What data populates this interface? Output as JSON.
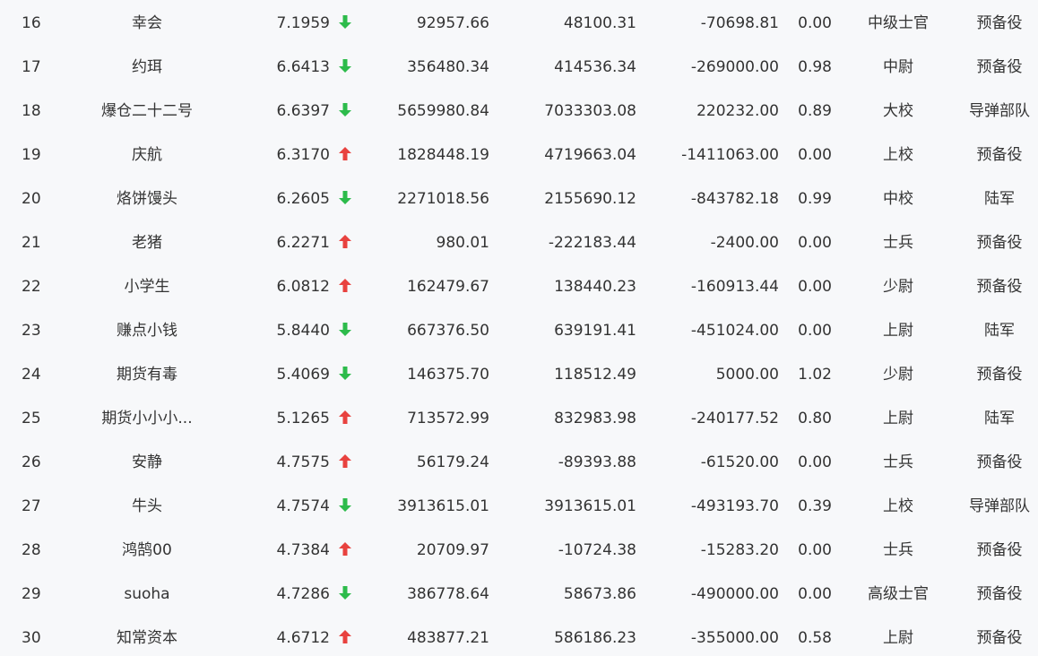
{
  "colors": {
    "up": "#e8423f",
    "down": "#2dbb4b",
    "text": "#333333",
    "background": "#f7f8fa"
  },
  "rows": [
    {
      "rank": "16",
      "name": "幸会",
      "score": "7.1959",
      "trend": "down",
      "value1": "92957.66",
      "value2": "48100.31",
      "value3": "-70698.81",
      "ratio": "0.00",
      "rank_title": "中级士官",
      "unit": "预备役"
    },
    {
      "rank": "17",
      "name": "约珥",
      "score": "6.6413",
      "trend": "down",
      "value1": "356480.34",
      "value2": "414536.34",
      "value3": "-269000.00",
      "ratio": "0.98",
      "rank_title": "中尉",
      "unit": "预备役"
    },
    {
      "rank": "18",
      "name": "爆仓二十二号",
      "score": "6.6397",
      "trend": "down",
      "value1": "5659980.84",
      "value2": "7033303.08",
      "value3": "220232.00",
      "ratio": "0.89",
      "rank_title": "大校",
      "unit": "导弹部队"
    },
    {
      "rank": "19",
      "name": "庆航",
      "score": "6.3170",
      "trend": "up",
      "value1": "1828448.19",
      "value2": "4719663.04",
      "value3": "-1411063.00",
      "ratio": "0.00",
      "rank_title": "上校",
      "unit": "预备役"
    },
    {
      "rank": "20",
      "name": "烙饼馒头",
      "score": "6.2605",
      "trend": "down",
      "value1": "2271018.56",
      "value2": "2155690.12",
      "value3": "-843782.18",
      "ratio": "0.99",
      "rank_title": "中校",
      "unit": "陆军"
    },
    {
      "rank": "21",
      "name": "老猪",
      "score": "6.2271",
      "trend": "up",
      "value1": "980.01",
      "value2": "-222183.44",
      "value3": "-2400.00",
      "ratio": "0.00",
      "rank_title": "士兵",
      "unit": "预备役"
    },
    {
      "rank": "22",
      "name": "小学生",
      "score": "6.0812",
      "trend": "up",
      "value1": "162479.67",
      "value2": "138440.23",
      "value3": "-160913.44",
      "ratio": "0.00",
      "rank_title": "少尉",
      "unit": "预备役"
    },
    {
      "rank": "23",
      "name": "赚点小钱",
      "score": "5.8440",
      "trend": "down",
      "value1": "667376.50",
      "value2": "639191.41",
      "value3": "-451024.00",
      "ratio": "0.00",
      "rank_title": "上尉",
      "unit": "陆军"
    },
    {
      "rank": "24",
      "name": "期货有毒",
      "score": "5.4069",
      "trend": "down",
      "value1": "146375.70",
      "value2": "118512.49",
      "value3": "5000.00",
      "ratio": "1.02",
      "rank_title": "少尉",
      "unit": "预备役"
    },
    {
      "rank": "25",
      "name": "期货小小小...",
      "score": "5.1265",
      "trend": "up",
      "value1": "713572.99",
      "value2": "832983.98",
      "value3": "-240177.52",
      "ratio": "0.80",
      "rank_title": "上尉",
      "unit": "陆军"
    },
    {
      "rank": "26",
      "name": "安静",
      "score": "4.7575",
      "trend": "up",
      "value1": "56179.24",
      "value2": "-89393.88",
      "value3": "-61520.00",
      "ratio": "0.00",
      "rank_title": "士兵",
      "unit": "预备役"
    },
    {
      "rank": "27",
      "name": "牛头",
      "score": "4.7574",
      "trend": "down",
      "value1": "3913615.01",
      "value2": "3913615.01",
      "value3": "-493193.70",
      "ratio": "0.39",
      "rank_title": "上校",
      "unit": "导弹部队"
    },
    {
      "rank": "28",
      "name": "鸿鹄00",
      "score": "4.7384",
      "trend": "up",
      "value1": "20709.97",
      "value2": "-10724.38",
      "value3": "-15283.20",
      "ratio": "0.00",
      "rank_title": "士兵",
      "unit": "预备役"
    },
    {
      "rank": "29",
      "name": "suoha",
      "score": "4.7286",
      "trend": "down",
      "value1": "386778.64",
      "value2": "58673.86",
      "value3": "-490000.00",
      "ratio": "0.00",
      "rank_title": "高级士官",
      "unit": "预备役"
    },
    {
      "rank": "30",
      "name": "知常资本",
      "score": "4.6712",
      "trend": "up",
      "value1": "483877.21",
      "value2": "586186.23",
      "value3": "-355000.00",
      "ratio": "0.58",
      "rank_title": "上尉",
      "unit": "预备役"
    }
  ]
}
